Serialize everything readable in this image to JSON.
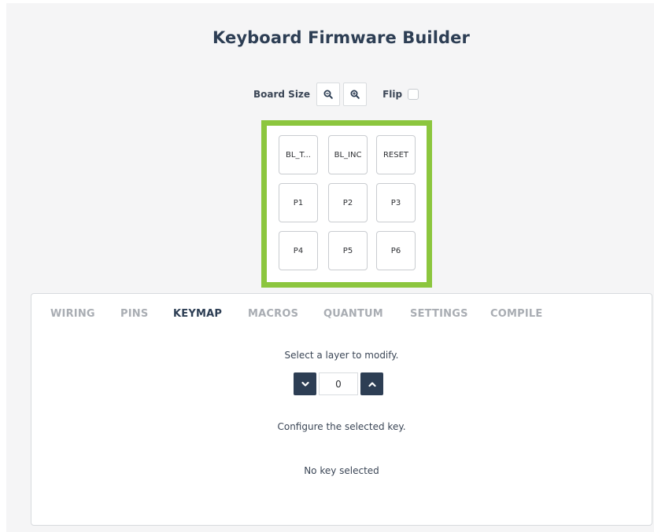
{
  "app": {
    "title": "Keyboard Firmware Builder"
  },
  "board_controls": {
    "size_label": "Board Size",
    "zoom_out_icon": "zoom-out-icon",
    "zoom_in_icon": "zoom-in-icon",
    "flip_label": "Flip",
    "flip_checked": false
  },
  "board": {
    "border_color": "#8cc63e",
    "keys": [
      [
        "BL_T...",
        "BL_INC",
        "RESET"
      ],
      [
        "P1",
        "P2",
        "P3"
      ],
      [
        "P4",
        "P5",
        "P6"
      ]
    ]
  },
  "tabs": [
    {
      "label": "WIRING",
      "active": false
    },
    {
      "label": "PINS",
      "active": false
    },
    {
      "label": "KEYMAP",
      "active": true
    },
    {
      "label": "MACROS",
      "active": false
    },
    {
      "label": "QUANTUM",
      "active": false
    },
    {
      "label": "SETTINGS",
      "active": false
    },
    {
      "label": "COMPILE",
      "active": false
    }
  ],
  "keymap": {
    "layer_prompt": "Select a layer to modify.",
    "layer_value": "0",
    "layer_down_icon": "chevron-down-icon",
    "layer_up_icon": "chevron-up-icon",
    "configure_prompt": "Configure the selected key.",
    "no_key_text": "No key selected"
  },
  "colors": {
    "accent_dark": "#2d3e54",
    "tab_inactive": "#a9adb3",
    "board_highlight": "#8cc63e"
  }
}
